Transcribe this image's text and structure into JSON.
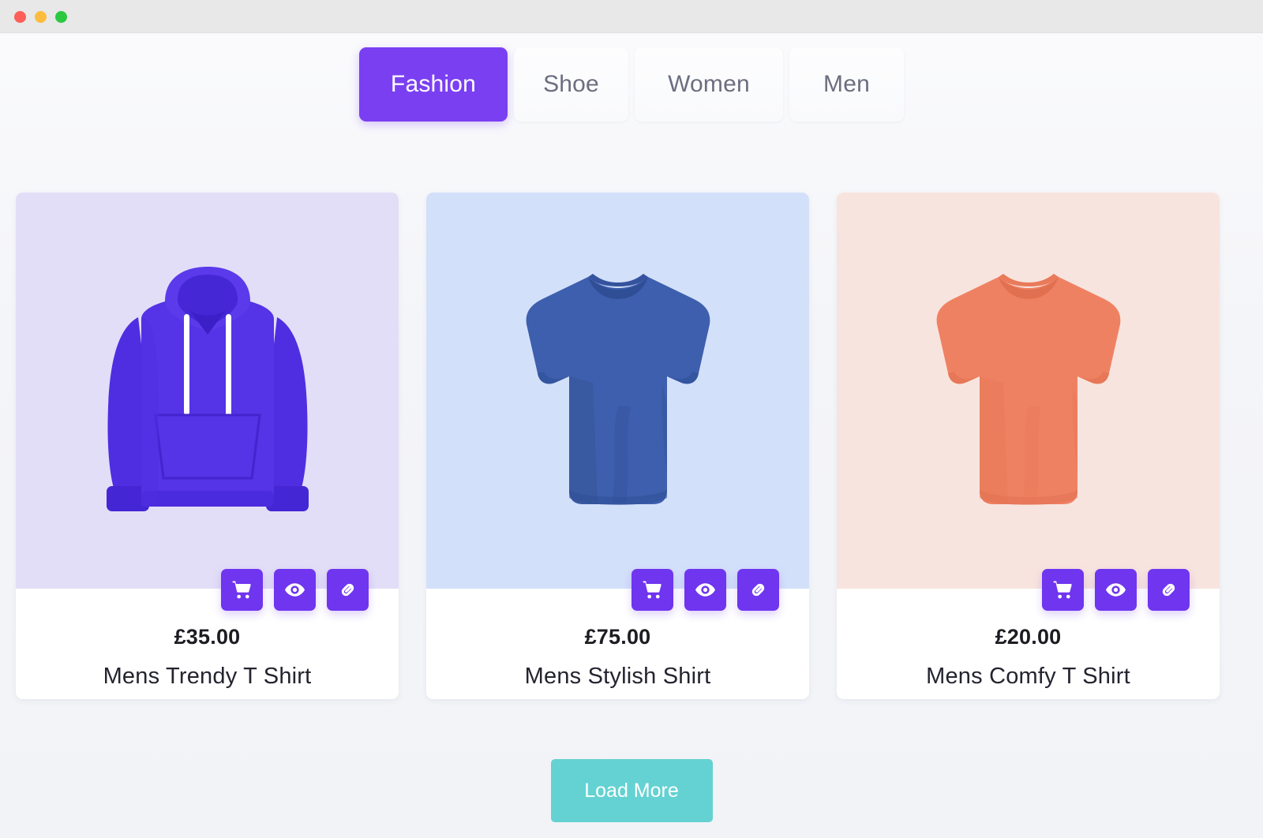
{
  "window": {
    "controls": [
      {
        "name": "close",
        "color": "#fc6058"
      },
      {
        "name": "minimize",
        "color": "#fdbc40"
      },
      {
        "name": "maximize",
        "color": "#2bc840"
      }
    ]
  },
  "tabs": {
    "active_index": 0,
    "items": [
      {
        "label": "Fashion",
        "active": true
      },
      {
        "label": "Shoe",
        "active": false
      },
      {
        "label": "Women",
        "active": false
      },
      {
        "label": "Men",
        "active": false
      }
    ]
  },
  "theme": {
    "accent_purple": "#7b3ff2",
    "button_purple": "#6f35ef",
    "loadmore_teal": "#64d2d2",
    "page_background": "#f2f3f7",
    "titlebar": "#e8e8e8",
    "card_background": "#ffffff"
  },
  "actions": {
    "add_to_cart": "cart-icon",
    "quick_view": "eye-icon",
    "copy_link": "link-icon"
  },
  "products": [
    {
      "price": "£35.00",
      "name": "Mens Trendy T Shirt",
      "image_background": "#e2def7",
      "garment": "hoodie",
      "garment_color": "#5533e6",
      "garment_shade": "#4627d6",
      "garment_highlight": "#6a4bf0",
      "drawstring_color": "#ffffff"
    },
    {
      "price": "£75.00",
      "name": "Mens Stylish Shirt",
      "image_background": "#d3e0fa",
      "garment": "tshirt",
      "garment_color": "#3d5fad",
      "garment_shade": "#2f4e96",
      "garment_highlight": "#4a6ec0",
      "drawstring_color": ""
    },
    {
      "price": "£20.00",
      "name": "Mens Comfy T Shirt",
      "image_background": "#f8e4de",
      "garment": "tshirt",
      "garment_color": "#ef8163",
      "garment_shade": "#e0704f",
      "garment_highlight": "#f79279",
      "drawstring_color": ""
    }
  ],
  "footer": {
    "load_more_label": "Load More"
  }
}
